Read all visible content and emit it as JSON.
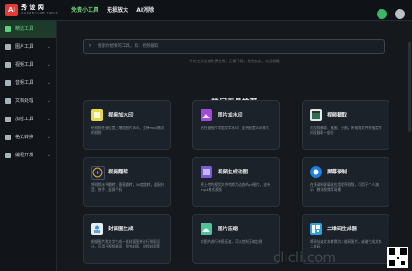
{
  "brand": {
    "badge": "AI",
    "name": "秀 设 网",
    "sub": "XIUSHEJI.COM TOOLS"
  },
  "topnav": [
    {
      "label": "免费小工具",
      "active": true
    },
    {
      "label": "无损放大",
      "active": false
    },
    {
      "label": "AI消除",
      "active": false
    }
  ],
  "sidebar": [
    {
      "label": "精选工具",
      "active": true,
      "chevron": ""
    },
    {
      "label": "图片工具",
      "active": false,
      "chevron": "⌄"
    },
    {
      "label": "视频工具",
      "active": false,
      "chevron": "⌄"
    },
    {
      "label": "音频工具",
      "active": false,
      "chevron": "⌄"
    },
    {
      "label": "文档处理",
      "active": false,
      "chevron": "⌄"
    },
    {
      "label": "加密工具",
      "active": false,
      "chevron": "⌄"
    },
    {
      "label": "格式转换",
      "active": false,
      "chevron": "⌄"
    },
    {
      "label": "编程开发",
      "active": false,
      "chevron": "⌄"
    }
  ],
  "search": {
    "placeholder": "搜索你想要的工具，如：视频截取"
  },
  "hint": "— 所有工具全部免费使用，无需下载，用完就走，欢迎收藏 —",
  "section_title": "热门工具推荐",
  "cards": [
    {
      "title": "视频加水印",
      "desc": "给视频任意位置上增加图片水印，支持mp4格式的视频",
      "color": "#e8d94a"
    },
    {
      "title": "图片加水印",
      "desc": "给任意图片增加文字水印，支持配置水印样式",
      "color": "#a14bd6"
    },
    {
      "title": "视频截取",
      "desc": "对视频截取、截图、分割，将视频文件按指定时间段截取一部分",
      "color": "#e4e8ea"
    },
    {
      "title": "视频翻转",
      "desc": "将视频水平翻转、垂直翻转，90度旋转，适配抖音、快手、竖屏手机",
      "color": "#1c2733"
    },
    {
      "title": "视频生成动图",
      "desc": "将上传的视频文件转换为动态的gif图片，支持mp4格式视频",
      "color": "#7a5cd6"
    },
    {
      "title": "屏幕录制",
      "desc": "在线录制屏幕或应用程序视频，可用于个人演示、教学视频等场景",
      "color": "#1f7fe0"
    },
    {
      "title": "封面图生成",
      "desc": "根据图片和文字生成一张封面图并进行排版设计，可用于视频封面、图书封面、课程封面等",
      "color": "#e7ecf0"
    },
    {
      "title": "图片压缩",
      "desc": "对图片进行有损压缩，可以控制压缩比例",
      "color": "#4fc29b"
    },
    {
      "title": "二维码生成器",
      "desc": "将网址或文本转换为二维码图片，或者生成文本二维码",
      "color": "#2ea3e3"
    }
  ],
  "watermark": "clicli.com"
}
